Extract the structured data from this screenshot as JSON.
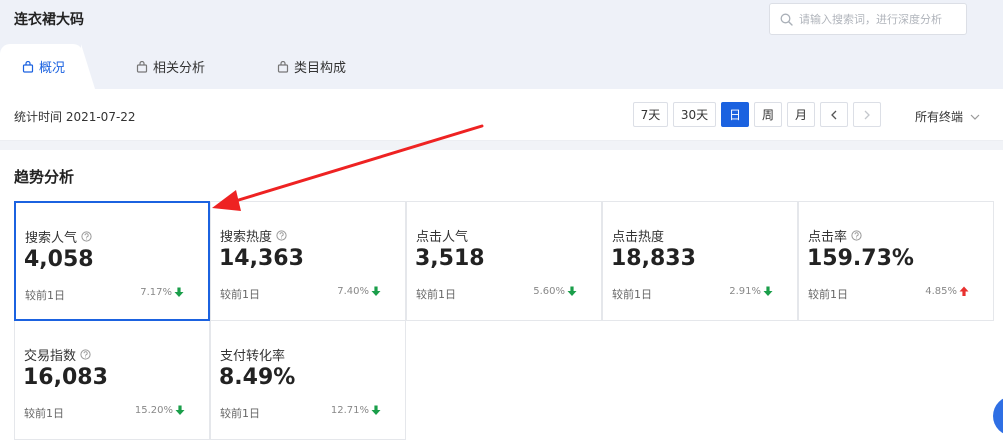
{
  "header": {
    "keyword": "连衣裙大码",
    "search_placeholder": "请输入搜索词，进行深度分析"
  },
  "tabs": [
    {
      "label": "概况",
      "active": true
    },
    {
      "label": "相关分析",
      "active": false
    },
    {
      "label": "类目构成",
      "active": false
    }
  ],
  "toolbar": {
    "stat_time": "统计时间 2021-07-22",
    "ranges": [
      {
        "label": "7天",
        "active": false
      },
      {
        "label": "30天",
        "active": false
      },
      {
        "label": "日",
        "active": true
      },
      {
        "label": "周",
        "active": false
      },
      {
        "label": "月",
        "active": false
      }
    ],
    "terminal": "所有终端"
  },
  "trend": {
    "title": "趋势分析",
    "metrics": [
      {
        "label": "搜索人气",
        "value": "4,058",
        "compare": "较前1日",
        "change": "7.17%",
        "direction": "down",
        "help": true
      },
      {
        "label": "搜索热度",
        "value": "14,363",
        "compare": "较前1日",
        "change": "7.40%",
        "direction": "down",
        "help": true
      },
      {
        "label": "点击人气",
        "value": "3,518",
        "compare": "较前1日",
        "change": "5.60%",
        "direction": "down",
        "help": false
      },
      {
        "label": "点击热度",
        "value": "18,833",
        "compare": "较前1日",
        "change": "2.91%",
        "direction": "down",
        "help": false
      },
      {
        "label": "点击率",
        "value": "159.73%",
        "compare": "较前1日",
        "change": "4.85%",
        "direction": "up",
        "help": true
      },
      {
        "label": "交易指数",
        "value": "16,083",
        "compare": "较前1日",
        "change": "15.20%",
        "direction": "down",
        "help": true
      },
      {
        "label": "支付转化率",
        "value": "8.49%",
        "compare": "较前1日",
        "change": "12.71%",
        "direction": "down",
        "help": false
      }
    ]
  },
  "colors": {
    "accent": "#1b62e0",
    "down": "#1a9e4a",
    "up": "#e8312f",
    "annotation": "#ee2222"
  }
}
